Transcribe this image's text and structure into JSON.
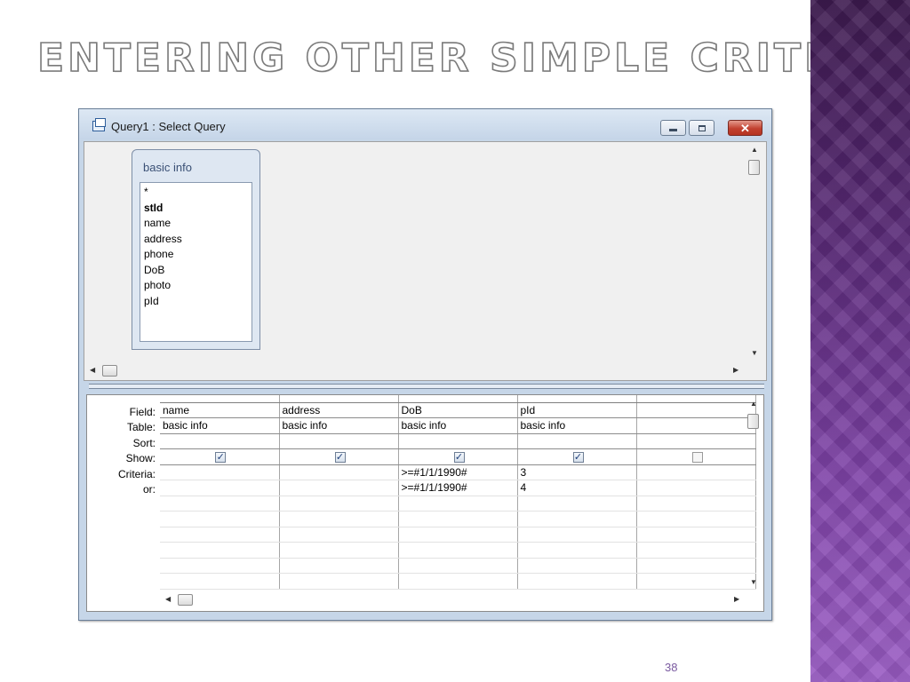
{
  "slide": {
    "title": "ENTERING OTHER SIMPLE CRITERIA",
    "page_number": "38"
  },
  "window": {
    "title": "Query1 : Select Query",
    "minimize_glyph": "",
    "maximize_glyph": "",
    "close_glyph": "✕"
  },
  "field_list": {
    "title": "basic info",
    "items": [
      "*",
      "stId",
      "name",
      "address",
      "phone",
      "DoB",
      "photo",
      "pId"
    ],
    "key_field": "stId"
  },
  "grid": {
    "row_labels": [
      "Field:",
      "Table:",
      "Sort:",
      "Show:",
      "Criteria:",
      "or:"
    ],
    "columns": [
      {
        "field": "name",
        "table": "basic info",
        "sort": "",
        "show": true,
        "criteria": "",
        "or": ""
      },
      {
        "field": "address",
        "table": "basic info",
        "sort": "",
        "show": true,
        "criteria": "",
        "or": ""
      },
      {
        "field": "DoB",
        "table": "basic info",
        "sort": "",
        "show": true,
        "criteria": ">=#1/1/1990#",
        "or": ">=#1/1/1990#"
      },
      {
        "field": "pId",
        "table": "basic info",
        "sort": "",
        "show": true,
        "criteria": "3",
        "or": "4"
      },
      {
        "field": "",
        "table": "",
        "sort": "",
        "show": false,
        "criteria": "",
        "or": ""
      }
    ]
  },
  "icons": {
    "window": "query-window-icon",
    "scroll_up": "scroll-up-arrow-icon",
    "scroll_down": "scroll-down-arrow-icon",
    "scroll_left": "scroll-left-arrow-icon",
    "scroll_right": "scroll-right-arrow-icon",
    "checkbox_checked": "checkbox-checked-icon",
    "checkbox_unchecked": "checkbox-unchecked-icon"
  },
  "colors": {
    "accent_purple": "#5a2a78",
    "window_frame": "#c6d6e8",
    "close_button": "#c2402f"
  }
}
